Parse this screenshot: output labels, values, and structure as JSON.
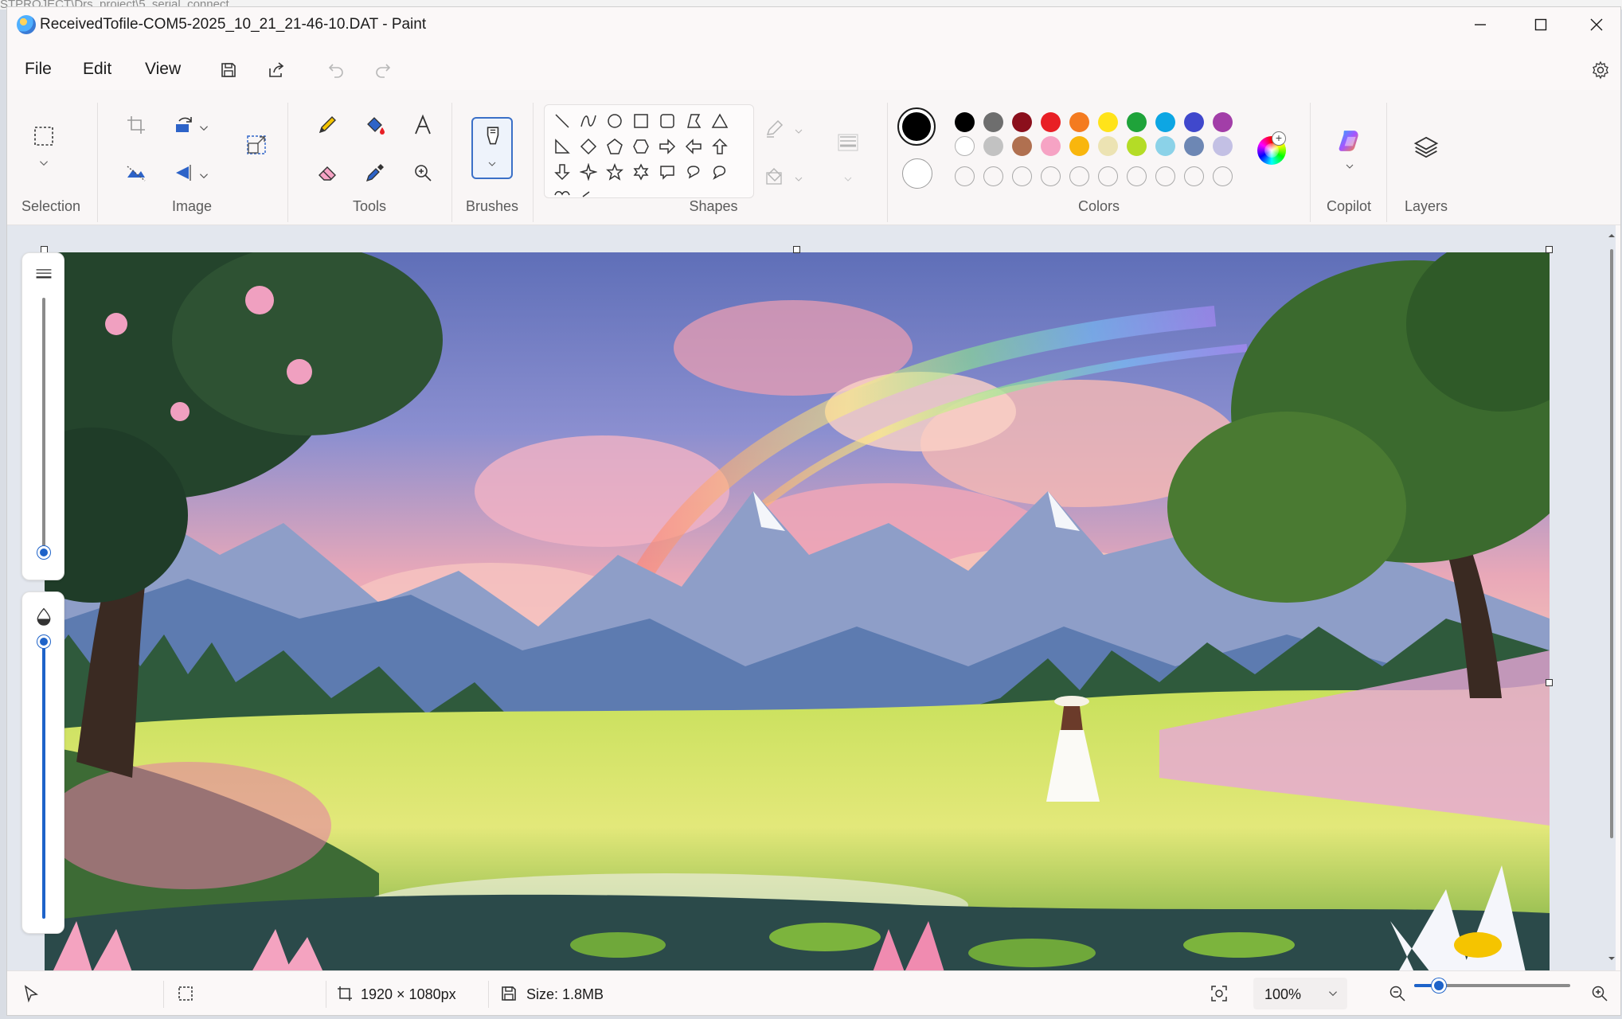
{
  "background_window_fragment": "STPROJECT\\Drs_project\\5_serial_connect",
  "window": {
    "title": "ReceivedTofile-COM5-2025_10_21_21-46-10.DAT - Paint"
  },
  "menu": {
    "file": "File",
    "edit": "Edit",
    "view": "View"
  },
  "ribbon": {
    "selection_label": "Selection",
    "image_label": "Image",
    "tools_label": "Tools",
    "brushes_label": "Brushes",
    "shapes_label": "Shapes",
    "colors_label": "Colors",
    "copilot_label": "Copilot",
    "layers_label": "Layers"
  },
  "colors": {
    "primary": "#000000",
    "secondary": "#ffffff",
    "row1": [
      "#000000",
      "#6e6e6e",
      "#8b0f1c",
      "#e81f25",
      "#f47b20",
      "#ffe31a",
      "#1fa33a",
      "#0da6e3",
      "#4048cc",
      "#a23ea8"
    ],
    "row2": [
      "#ffffff",
      "#c2c2c2",
      "#b07050",
      "#f6a3c4",
      "#f9b60d",
      "#ece3b3",
      "#b4dc26",
      "#8bd2e8",
      "#6d87b4",
      "#c3c0e4"
    ]
  },
  "canvas": {
    "zoom_slider_fraction": 0.03
  },
  "statusbar": {
    "dimensions": "1920 × 1080px",
    "size": "Size: 1.8MB",
    "zoom": "100%"
  }
}
